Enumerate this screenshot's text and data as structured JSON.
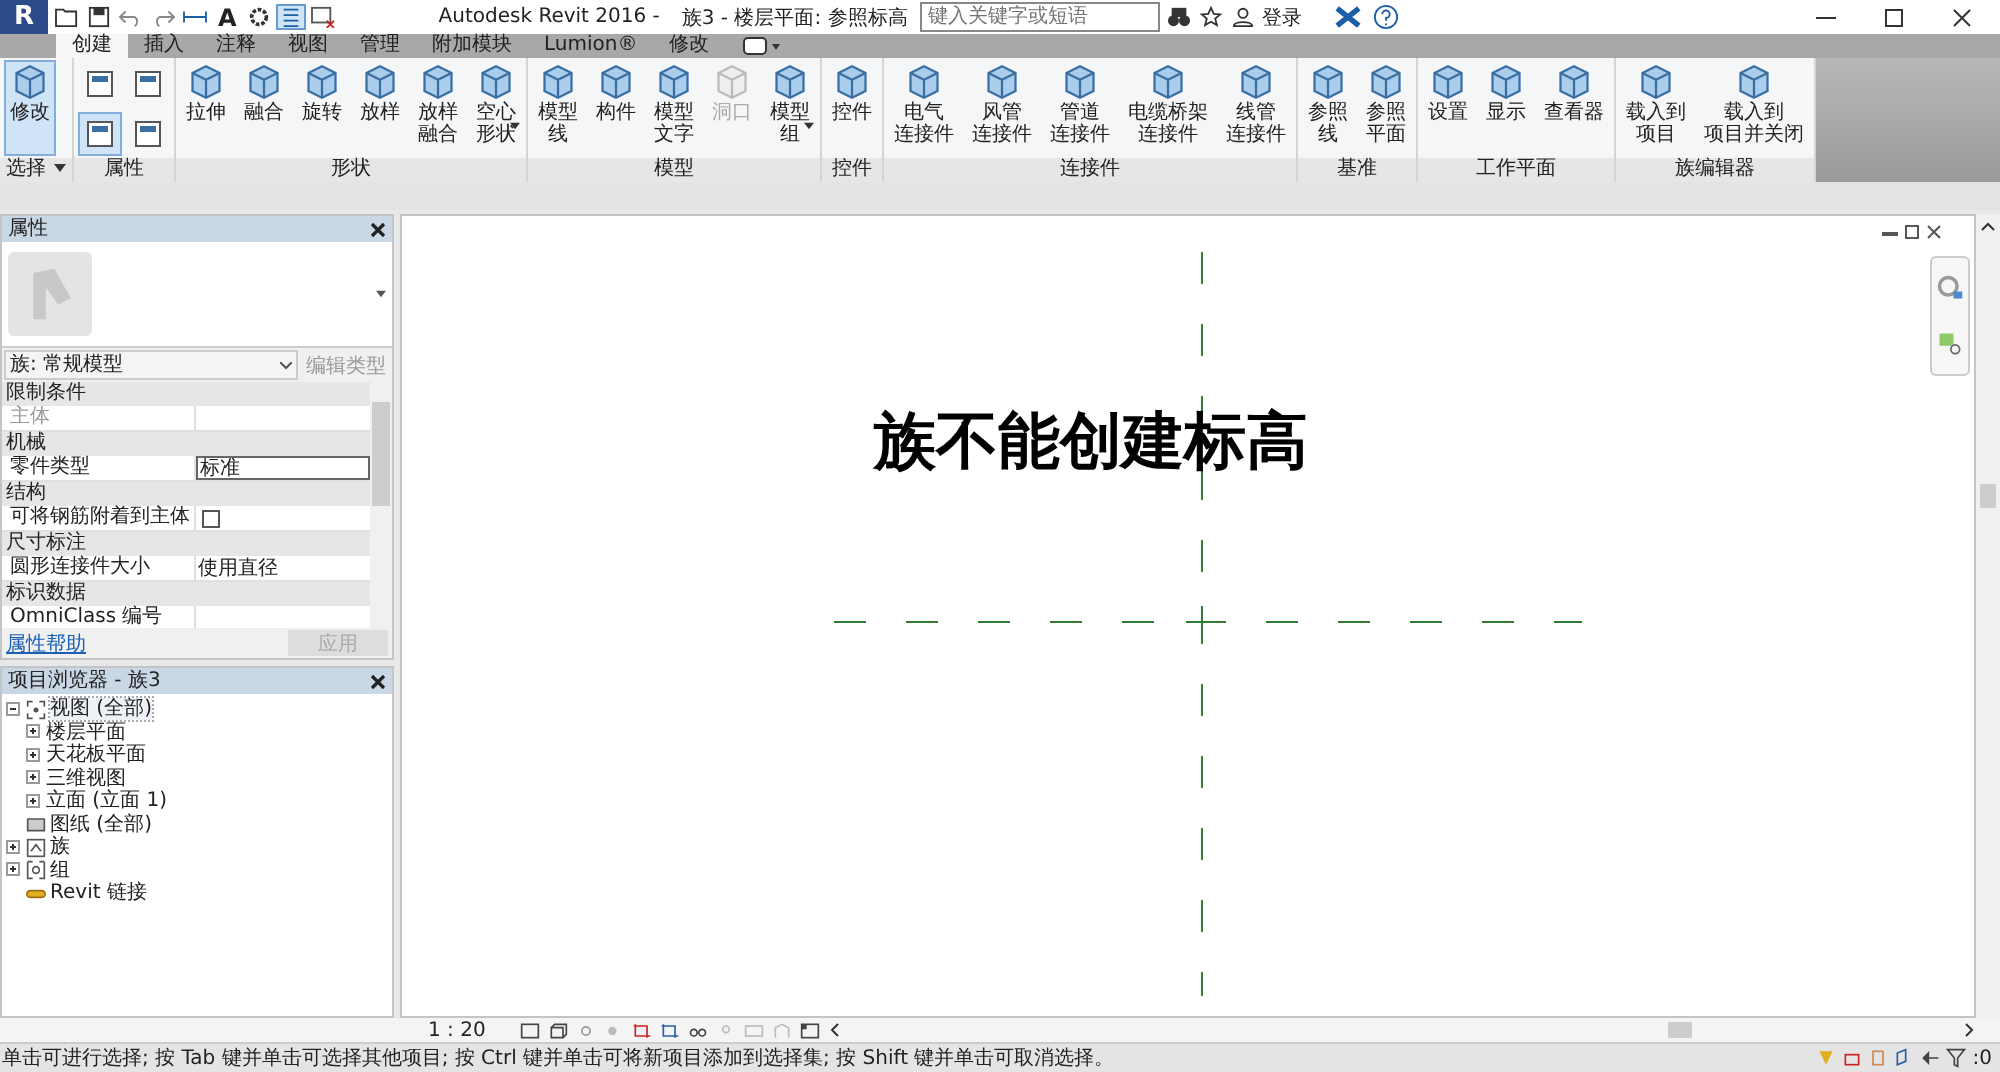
{
  "title_bar": {
    "app_button": "R",
    "text_tool": "A",
    "thin_lines": {
      "selected": true
    },
    "app_title": "Autodesk Revit 2016 -",
    "document": "族3 - 楼层平面: 参照标高",
    "search": {
      "placeholder": "键入关键字或短语"
    },
    "login": "登录"
  },
  "ribbon": {
    "tabs": [
      {
        "label": "创建",
        "selected": true
      },
      {
        "label": "插入",
        "selected": false
      },
      {
        "label": "注释",
        "selected": false
      },
      {
        "label": "视图",
        "selected": false
      },
      {
        "label": "管理",
        "selected": false
      },
      {
        "label": "附加模块",
        "selected": false
      },
      {
        "label": "Lumion®",
        "selected": false
      },
      {
        "label": "修改",
        "selected": false
      }
    ],
    "panels": [
      {
        "label": "选择",
        "dropdown": true,
        "tools": [
          {
            "lines": [
              "修改"
            ],
            "selected": true,
            "disabled": false,
            "dropdown": false
          }
        ]
      },
      {
        "label": "属性",
        "dropdown": false,
        "icon_buttons": [
          {
            "selected": false
          },
          {
            "selected": false
          },
          {
            "selected": true
          },
          {
            "selected": false
          }
        ]
      },
      {
        "label": "形状",
        "dropdown": false,
        "tools": [
          {
            "lines": [
              "拉伸"
            ],
            "selected": false,
            "disabled": false,
            "dropdown": false
          },
          {
            "lines": [
              "融合"
            ],
            "selected": false,
            "disabled": false,
            "dropdown": false
          },
          {
            "lines": [
              "旋转"
            ],
            "selected": false,
            "disabled": false,
            "dropdown": false
          },
          {
            "lines": [
              "放样"
            ],
            "selected": false,
            "disabled": false,
            "dropdown": false
          },
          {
            "lines": [
              "放样",
              "融合"
            ],
            "selected": false,
            "disabled": false,
            "dropdown": false
          },
          {
            "lines": [
              "空心",
              "形状"
            ],
            "selected": false,
            "disabled": false,
            "dropdown": true
          }
        ]
      },
      {
        "label": "模型",
        "dropdown": false,
        "tools": [
          {
            "lines": [
              "模型",
              "线"
            ],
            "selected": false,
            "disabled": false,
            "dropdown": false
          },
          {
            "lines": [
              "构件"
            ],
            "selected": false,
            "disabled": false,
            "dropdown": false
          },
          {
            "lines": [
              "模型",
              "文字"
            ],
            "selected": false,
            "disabled": false,
            "dropdown": false
          },
          {
            "lines": [
              "洞口"
            ],
            "selected": false,
            "disabled": true,
            "dropdown": false
          },
          {
            "lines": [
              "模型",
              "组"
            ],
            "selected": false,
            "disabled": false,
            "dropdown": true
          }
        ]
      },
      {
        "label": "控件",
        "dropdown": false,
        "tools": [
          {
            "lines": [
              "控件"
            ],
            "selected": false,
            "disabled": false,
            "dropdown": false
          }
        ]
      },
      {
        "label": "连接件",
        "dropdown": false,
        "tools": [
          {
            "lines": [
              "电气",
              "连接件"
            ],
            "selected": false,
            "disabled": false,
            "dropdown": false
          },
          {
            "lines": [
              "风管",
              "连接件"
            ],
            "selected": false,
            "disabled": false,
            "dropdown": false
          },
          {
            "lines": [
              "管道",
              "连接件"
            ],
            "selected": false,
            "disabled": false,
            "dropdown": false
          },
          {
            "lines": [
              "电缆桥架",
              "连接件"
            ],
            "selected": false,
            "disabled": false,
            "dropdown": false
          },
          {
            "lines": [
              "线管",
              "连接件"
            ],
            "selected": false,
            "disabled": false,
            "dropdown": false
          }
        ]
      },
      {
        "label": "基准",
        "dropdown": false,
        "tools": [
          {
            "lines": [
              "参照",
              "线"
            ],
            "selected": false,
            "disabled": false,
            "dropdown": false
          },
          {
            "lines": [
              "参照",
              "平面"
            ],
            "selected": false,
            "disabled": false,
            "dropdown": false
          }
        ]
      },
      {
        "label": "工作平面",
        "dropdown": false,
        "tools": [
          {
            "lines": [
              "设置"
            ],
            "selected": false,
            "disabled": false,
            "dropdown": false
          },
          {
            "lines": [
              "显示"
            ],
            "selected": false,
            "disabled": false,
            "dropdown": false
          },
          {
            "lines": [
              "查看器"
            ],
            "selected": false,
            "disabled": false,
            "dropdown": false
          }
        ]
      },
      {
        "label": "族编辑器",
        "dropdown": false,
        "tools": [
          {
            "lines": [
              "载入到",
              "项目"
            ],
            "selected": false,
            "disabled": false,
            "dropdown": false
          },
          {
            "lines": [
              "载入到",
              "项目并关闭"
            ],
            "selected": false,
            "disabled": false,
            "dropdown": false
          }
        ]
      }
    ]
  },
  "properties": {
    "title": "属性",
    "type_selector": "族: 常规模型",
    "edit_type": {
      "label": "编辑类型",
      "disabled": true
    },
    "groups": [
      {
        "name": "限制条件",
        "rows": [
          {
            "label": "主体",
            "kind": "text",
            "disabled": true,
            "editing": false
          }
        ]
      },
      {
        "name": "机械",
        "rows": [
          {
            "label": "零件类型",
            "kind": "text",
            "value": "标准",
            "disabled": false,
            "editing": true
          }
        ]
      },
      {
        "name": "结构",
        "rows": [
          {
            "label": "可将钢筋附着到主体",
            "kind": "checkbox",
            "checked": false,
            "disabled": false
          }
        ]
      },
      {
        "name": "尺寸标注",
        "rows": [
          {
            "label": "圆形连接件大小",
            "kind": "text",
            "value": "使用直径",
            "disabled": false,
            "editing": false
          }
        ]
      },
      {
        "name": "标识数据",
        "rows": [
          {
            "label": "OmniClass 编号",
            "kind": "text",
            "disabled": false,
            "editing": false
          }
        ]
      }
    ],
    "help_link": "属性帮助",
    "apply": {
      "label": "应用",
      "disabled": true
    }
  },
  "project_browser": {
    "title": "项目浏览器 - 族3",
    "tree": [
      {
        "label": "视图 (全部)",
        "kind": "views",
        "expanded": true,
        "selected": true,
        "children": [
          {
            "label": "楼层平面",
            "expanded": false,
            "selected": false
          },
          {
            "label": "天花板平面",
            "expanded": false,
            "selected": false
          },
          {
            "label": "三维视图",
            "expanded": false,
            "selected": false
          },
          {
            "label": "立面 (立面 1)",
            "expanded": false,
            "selected": false
          }
        ]
      },
      {
        "label": "图纸 (全部)",
        "kind": "sheets",
        "selected": false
      },
      {
        "label": "族",
        "kind": "families",
        "expanded": false,
        "selected": false
      },
      {
        "label": "组",
        "kind": "groups",
        "expanded": false,
        "selected": false
      },
      {
        "label": "Revit 链接",
        "kind": "links",
        "selected": false
      }
    ]
  },
  "canvas": {
    "heading": "族不能创建标高"
  },
  "view_bar": {
    "scale": "1 : 20"
  },
  "status_bar": {
    "message": "单击可进行选择; 按 Tab 键并单击可选择其他项目; 按 Ctrl 键并单击可将新项目添加到选择集; 按 Shift 键并单击可取消选择。",
    "filter_count": ":0"
  }
}
